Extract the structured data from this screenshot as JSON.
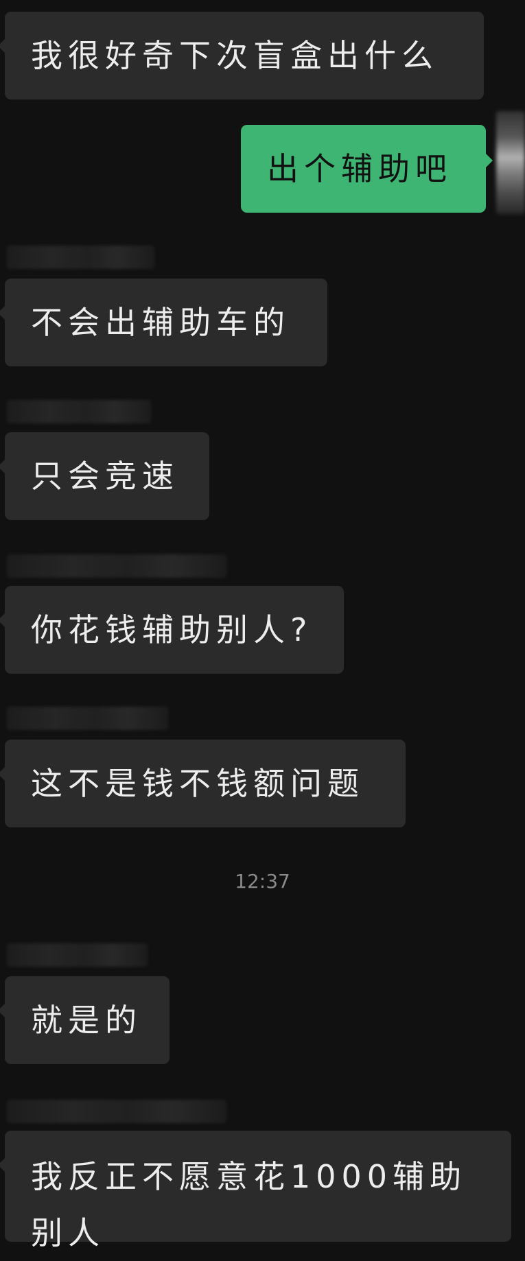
{
  "messages": [
    {
      "side": "incoming",
      "text": "我很好奇下次盲盒出什么"
    },
    {
      "side": "outgoing",
      "text": "出个辅助吧"
    },
    {
      "side": "incoming",
      "text": "不会出辅助车的"
    },
    {
      "side": "incoming",
      "text": "只会竞速"
    },
    {
      "side": "incoming",
      "text": "你花钱辅助别人?"
    },
    {
      "side": "incoming",
      "text": "这不是钱不钱额问题"
    },
    {
      "side": "incoming",
      "text": "就是的"
    },
    {
      "side": "incoming",
      "text": "我反正不愿意花1000辅助别人"
    }
  ],
  "timestamp": "12:37",
  "colors": {
    "background": "#111111",
    "incoming_bubble": "#2b2b2b",
    "outgoing_bubble": "#3fb574"
  }
}
